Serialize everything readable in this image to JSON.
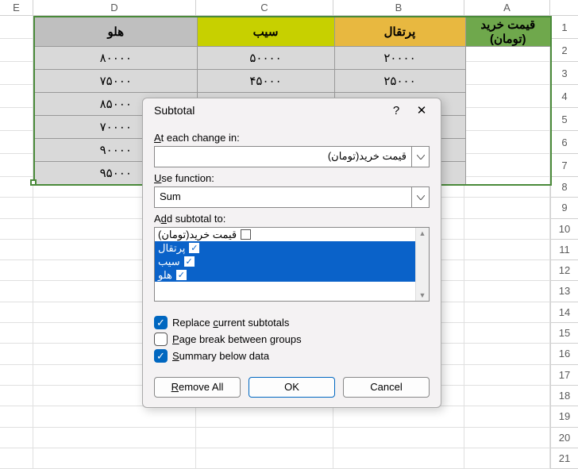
{
  "columns": {
    "E": "E",
    "D": "D",
    "C": "C",
    "B": "B",
    "A": "A"
  },
  "rows": [
    "1",
    "2",
    "3",
    "4",
    "5",
    "6",
    "7",
    "8",
    "9",
    "10",
    "11",
    "12",
    "13",
    "14",
    "15",
    "16",
    "17",
    "18",
    "19",
    "20",
    "21"
  ],
  "table": {
    "headers": {
      "D": "هلو",
      "C": "سیب",
      "B": "پرتقال",
      "A_line1": "قیمت خرید",
      "A_line2": "(تومان)"
    },
    "rows": [
      {
        "D": "۸۰۰۰۰",
        "C": "۵۰۰۰۰",
        "B": "۲۰۰۰۰"
      },
      {
        "D": "۷۵۰۰۰",
        "C": "۴۵۰۰۰",
        "B": "۲۵۰۰۰"
      },
      {
        "D": "۸۵۰۰۰",
        "C": "",
        "B": ""
      },
      {
        "D": "۷۰۰۰۰",
        "C": "",
        "B": ""
      },
      {
        "D": "۹۰۰۰۰",
        "C": "",
        "B": ""
      },
      {
        "D": "۹۵۰۰۰",
        "C": "",
        "B": ""
      }
    ]
  },
  "dialog": {
    "title": "Subtotal",
    "labels": {
      "at_each_change": "At each change in:",
      "use_function": "Use function:",
      "add_subtotal_to": "Add subtotal to:"
    },
    "change_combo": "قیمت خرید(تومان)",
    "function_combo": "Sum",
    "checklist": [
      {
        "label": "قیمت خرید(تومان)",
        "checked": false,
        "selected": false
      },
      {
        "label": "پرتقال",
        "checked": true,
        "selected": true
      },
      {
        "label": "سیب",
        "checked": true,
        "selected": true
      },
      {
        "label": "هلو",
        "checked": true,
        "selected": true
      }
    ],
    "options": {
      "replace": {
        "label": "Replace current subtotals",
        "checked": true
      },
      "page_break": {
        "label": "Page break between groups",
        "checked": false
      },
      "summary": {
        "label": "Summary below data",
        "checked": true
      }
    },
    "buttons": {
      "remove_all": "Remove All",
      "ok": "OK",
      "cancel": "Cancel"
    }
  }
}
